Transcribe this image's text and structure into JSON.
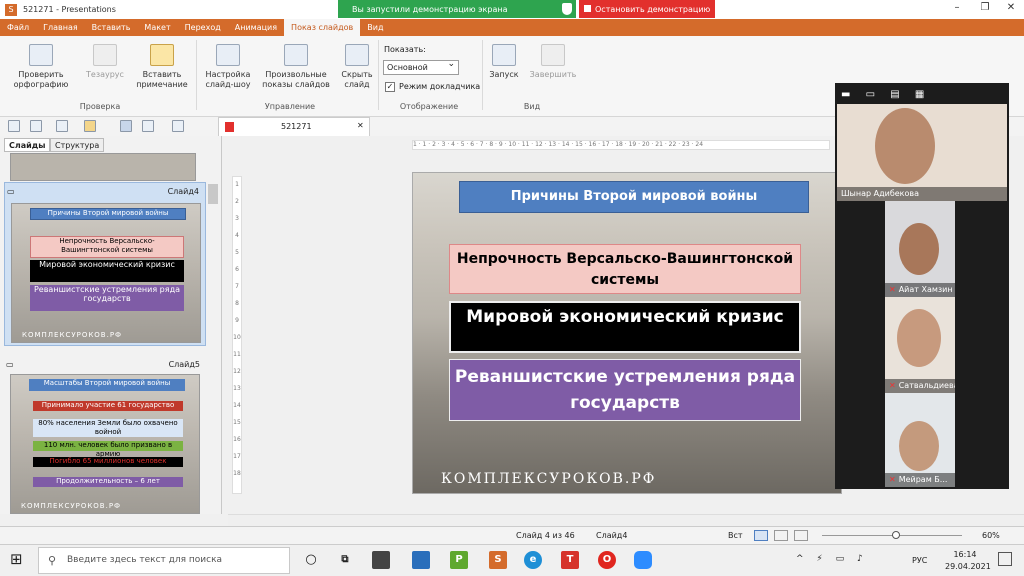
{
  "window": {
    "title": "521271 - Presentations",
    "app_icon": "S"
  },
  "share": {
    "banner": "Вы запустили демонстрацию экрана",
    "stop": "Остановить демонстрацию"
  },
  "menu": {
    "tabs": [
      "Файл",
      "Главная",
      "Вставить",
      "Макет",
      "Переход",
      "Анимация",
      "Показ слайдов",
      "Вид"
    ],
    "active": "Показ слайдов"
  },
  "ribbon": {
    "spell": "Проверить орфографию",
    "thesaurus": "Тезаурус",
    "insert_note": "Вставить примечание",
    "group_check": "Проверка",
    "setup": "Настройка слайд-шоу",
    "custom": "Произвольные показы слайдов",
    "hide": "Скрыть слайд",
    "group_manage": "Управление",
    "show_label": "Показать:",
    "show_value": "Основной",
    "presenter_mode": "Режим докладчика",
    "group_display": "Отображение",
    "start": "Запуск",
    "finish": "Завершить",
    "group_view": "Вид"
  },
  "document": {
    "tab": "521271"
  },
  "panel": {
    "tab_slides": "Слайды",
    "tab_structure": "Структура",
    "slide4_label": "Слайд4",
    "slide5_label": "Слайд5",
    "thumb4": {
      "title": "Причины Второй мировой войны",
      "b1": "Непрочность Версальско-Вашингтонской системы",
      "b2": "Мировой экономический кризис",
      "b3": "Реваншистские устремления ряда государств"
    },
    "thumb5": {
      "title": "Масштабы Второй мировой войны",
      "l1": "Принимало участие 61 государство",
      "l2": "80% населения Земли было охвачено войной",
      "l3": "110 млн. человек было призвано в армию",
      "l4": "Погибло 65 миллионов человек",
      "l5": "Продолжительность – 6 лет"
    },
    "watermark": "КОМПЛЕКСУРОКОВ.РФ"
  },
  "ruler": {
    "h_ticks": "1 · 1 · 2 · 3 · 4 · 5 · 6 · 7 · 8 · 9 · 10 · 11 · 12 · 13 · 14 · 15 · 16 · 17 · 18 · 19 · 20 · 21 · 22 · 23 · 24",
    "v_ticks": [
      "1",
      "2",
      "3",
      "4",
      "5",
      "6",
      "7",
      "8",
      "9",
      "10",
      "11",
      "12",
      "13",
      "14",
      "15",
      "16",
      "17",
      "18"
    ]
  },
  "slide": {
    "title": "Причины Второй мировой войны",
    "box1": "Непрочность Версальско-Вашингтонской системы",
    "box2": "Мировой экономический кризис",
    "box3": "Реваншистские устремления ряда государств",
    "watermark": "КОМПЛЕКСУРОКОВ.РФ"
  },
  "zoom": {
    "p1": "Шынар Адибекова",
    "p2": "Айат Хамзин",
    "p3": "Сатвальдиева Жанна",
    "p4": "Мейрам Б..."
  },
  "status": {
    "slide_pos": "Слайд 4 из 46",
    "slide_name": "Слайд4",
    "view": "Вст",
    "zoom": "60%"
  },
  "taskbar": {
    "search": "Введите здесь текст для поиска",
    "time": "16:14",
    "date": "29.04.2021",
    "lang": "РУС"
  },
  "colors": {
    "accent": "#d46b2b",
    "share_green": "#2ea44f",
    "stop_red": "#e2302d",
    "title_blue": "#4f7fc1",
    "pink": "#f4c9c4",
    "purple": "#7f5ca6"
  }
}
